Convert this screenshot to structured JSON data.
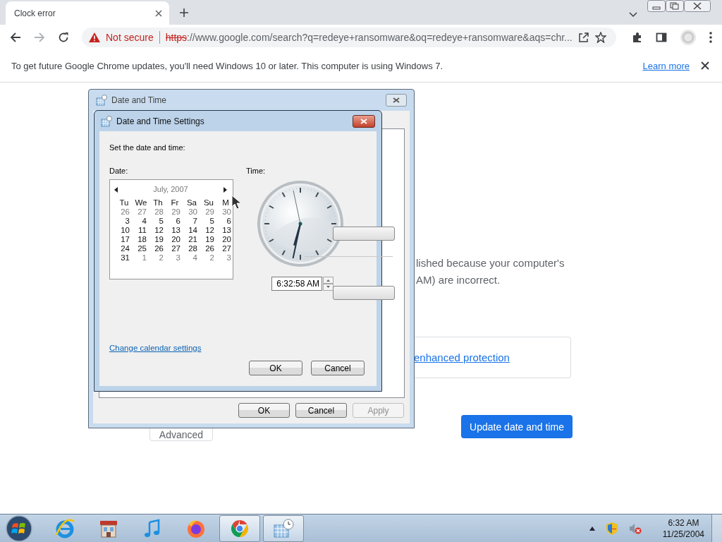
{
  "browser": {
    "tab": {
      "title": "Clock error",
      "selected": true
    },
    "address": {
      "warning": "Not secure",
      "scheme": "https",
      "rest": "://www.google.com/search?q=redeye+ransomware&oq=redeye+ransomware&aqs=chr..."
    },
    "infobar": {
      "text": "To get future Google Chrome updates, you'll need Windows 10 or later. This computer is using Windows 7.",
      "link": "Learn more"
    }
  },
  "page": {
    "lines": [
      "lished because your computer's",
      "AM) are incorrect."
    ],
    "card_link": "enhanced protection",
    "advanced": "Advanced",
    "primary": "Update date and time"
  },
  "outer_dialog": {
    "title": "Date and Time",
    "buttons": [
      {
        "label": "OK",
        "disabled": false
      },
      {
        "label": "Cancel",
        "disabled": false
      },
      {
        "label": "Apply",
        "disabled": true
      }
    ]
  },
  "inner_dialog": {
    "title": "Date and Time Settings",
    "prompt": "Set the date and time:",
    "date_label": "Date:",
    "time_label": "Time:",
    "calendar": {
      "header": "July, 2007",
      "days": [
        "Tu",
        "We",
        "Th",
        "Fr",
        "Sa",
        "Su",
        "M"
      ],
      "weeks": [
        [
          {
            "text": "26",
            "muted": true
          },
          {
            "text": "27",
            "muted": true
          },
          {
            "text": "28",
            "muted": true
          },
          {
            "text": "29",
            "muted": true
          },
          {
            "text": "30",
            "muted": true
          },
          {
            "text": "29",
            "muted": true
          },
          {
            "text": "30",
            "muted": true
          }
        ],
        [
          {
            "text": "3",
            "muted": false
          },
          {
            "text": "4",
            "muted": false
          },
          {
            "text": "5",
            "muted": false
          },
          {
            "text": "6",
            "muted": false
          },
          {
            "text": "7",
            "muted": false
          },
          {
            "text": "5",
            "muted": false
          },
          {
            "text": "6",
            "muted": false
          }
        ],
        [
          {
            "text": "10",
            "muted": false
          },
          {
            "text": "11",
            "muted": false
          },
          {
            "text": "12",
            "muted": false
          },
          {
            "text": "13",
            "muted": false
          },
          {
            "text": "14",
            "muted": false
          },
          {
            "text": "12",
            "muted": false
          },
          {
            "text": "13",
            "muted": false
          }
        ],
        [
          {
            "text": "17",
            "muted": false
          },
          {
            "text": "18",
            "muted": false
          },
          {
            "text": "19",
            "muted": false
          },
          {
            "text": "20",
            "muted": false
          },
          {
            "text": "21",
            "muted": false
          },
          {
            "text": "19",
            "muted": false
          },
          {
            "text": "20",
            "muted": false
          }
        ],
        [
          {
            "text": "24",
            "muted": false
          },
          {
            "text": "25",
            "muted": false
          },
          {
            "text": "26",
            "muted": false
          },
          {
            "text": "27",
            "muted": false
          },
          {
            "text": "28",
            "muted": false
          },
          {
            "text": "26",
            "muted": false
          },
          {
            "text": "27",
            "muted": false
          }
        ],
        [
          {
            "text": "31",
            "muted": false
          },
          {
            "text": "1",
            "muted": true
          },
          {
            "text": "2",
            "muted": true
          },
          {
            "text": "3",
            "muted": true
          },
          {
            "text": "4",
            "muted": true
          },
          {
            "text": "2",
            "muted": true
          },
          {
            "text": "3",
            "muted": true
          }
        ]
      ]
    },
    "time_value": "6:32:58 AM",
    "link": "Change calendar settings",
    "buttons": [
      "OK",
      "Cancel"
    ]
  },
  "taskbar": {
    "apps": [
      {
        "kind": "ie",
        "selected": false
      },
      {
        "kind": "store",
        "selected": false
      },
      {
        "kind": "music",
        "selected": false
      },
      {
        "kind": "firefox",
        "selected": false
      },
      {
        "kind": "chrome",
        "selected": true
      },
      {
        "kind": "datetime",
        "selected": true
      }
    ],
    "time": "6:32 AM",
    "date": "11/25/2004"
  }
}
